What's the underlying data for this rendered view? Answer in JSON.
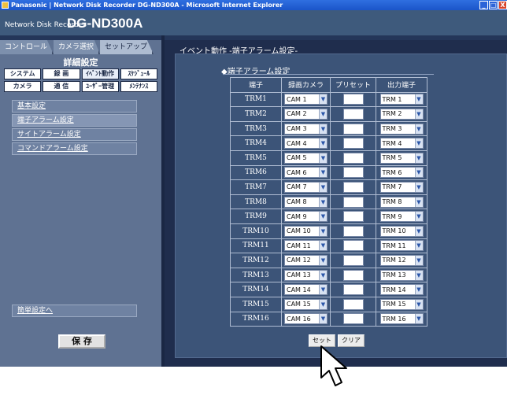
{
  "window": {
    "title": "Panasonic | Network Disk Recorder DG-ND300A - Microsoft Internet Explorer",
    "buttons": [
      "_",
      "□",
      "X"
    ]
  },
  "header": {
    "brand_small": "Network Disk Recorder",
    "brand_big": "DG-ND300A"
  },
  "tabs": [
    {
      "label": "コントロール"
    },
    {
      "label": "カメラ選択"
    },
    {
      "label": "セットアップ"
    }
  ],
  "settings_title": "詳細設定",
  "categories": [
    "システム",
    "録 画",
    "ｲﾍﾞﾝﾄ動作",
    "ｽｹｼﾞｭｰﾙ",
    "カメラ",
    "通 信",
    "ﾕｰｻﾞｰ管理",
    "ﾒﾝﾃﾅﾝｽ"
  ],
  "submenu": [
    "基本設定",
    "端子アラーム設定",
    "サイトアラーム設定",
    "コマンドアラーム設定"
  ],
  "easy_setup_link": "簡単設定へ",
  "save_label": "保 存",
  "page_heading": "イベント動作 -端子アラーム設定-",
  "section_title": "◆端子アラーム設定",
  "table": {
    "headers": [
      "端子",
      "録画カメラ",
      "プリセット",
      "出力端子"
    ],
    "rows": [
      {
        "term": "TRM1",
        "cam": "CAM 1",
        "out": "TRM 1"
      },
      {
        "term": "TRM2",
        "cam": "CAM 2",
        "out": "TRM 2"
      },
      {
        "term": "TRM3",
        "cam": "CAM 3",
        "out": "TRM 3"
      },
      {
        "term": "TRM4",
        "cam": "CAM 4",
        "out": "TRM 4"
      },
      {
        "term": "TRM5",
        "cam": "CAM 5",
        "out": "TRM 5"
      },
      {
        "term": "TRM6",
        "cam": "CAM 6",
        "out": "TRM 6"
      },
      {
        "term": "TRM7",
        "cam": "CAM 7",
        "out": "TRM 7"
      },
      {
        "term": "TRM8",
        "cam": "CAM 8",
        "out": "TRM 8"
      },
      {
        "term": "TRM9",
        "cam": "CAM 9",
        "out": "TRM 9"
      },
      {
        "term": "TRM10",
        "cam": "CAM 10",
        "out": "TRM 10"
      },
      {
        "term": "TRM11",
        "cam": "CAM 11",
        "out": "TRM 11"
      },
      {
        "term": "TRM12",
        "cam": "CAM 12",
        "out": "TRM 12"
      },
      {
        "term": "TRM13",
        "cam": "CAM 13",
        "out": "TRM 13"
      },
      {
        "term": "TRM14",
        "cam": "CAM 14",
        "out": "TRM 14"
      },
      {
        "term": "TRM15",
        "cam": "CAM 15",
        "out": "TRM 15"
      },
      {
        "term": "TRM16",
        "cam": "CAM 16",
        "out": "TRM 16"
      }
    ]
  },
  "actions": {
    "set_label": "セット",
    "clear_label": "クリア"
  },
  "icons": {
    "dropdown": "chevron-down-icon",
    "cursor": "arrow-cursor-icon"
  }
}
